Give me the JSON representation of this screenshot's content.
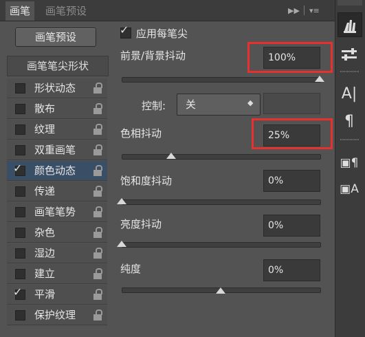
{
  "tabs": [
    {
      "label": "画笔",
      "active": true
    },
    {
      "label": "画笔预设",
      "active": false
    }
  ],
  "panel": {
    "preset_button": "画笔预设",
    "tip_shape_label": "画笔笔尖形状",
    "options": [
      {
        "label": "形状动态",
        "checked": false,
        "selected": false
      },
      {
        "label": "散布",
        "checked": false,
        "selected": false
      },
      {
        "label": "纹理",
        "checked": false,
        "selected": false
      },
      {
        "label": "双重画笔",
        "checked": false,
        "selected": false
      },
      {
        "label": "颜色动态",
        "checked": true,
        "selected": true
      },
      {
        "label": "传递",
        "checked": false,
        "selected": false
      },
      {
        "label": "画笔笔势",
        "checked": false,
        "selected": false
      },
      {
        "label": "杂色",
        "checked": false,
        "selected": false
      },
      {
        "label": "湿边",
        "checked": false,
        "selected": false
      },
      {
        "label": "建立",
        "checked": false,
        "selected": false
      },
      {
        "label": "平滑",
        "checked": true,
        "selected": false
      },
      {
        "label": "保护纹理",
        "checked": false,
        "selected": false
      }
    ]
  },
  "settings": {
    "apply_per_tip": {
      "label": "应用每笔尖",
      "checked": true
    },
    "fg_bg_jitter": {
      "label": "前景/背景抖动",
      "value": "100%",
      "level": 1.0
    },
    "control": {
      "label": "控制:",
      "value": "关",
      "field": ""
    },
    "hue_jitter": {
      "label": "色相抖动",
      "value": "25%",
      "level": 0.25
    },
    "saturation_jitter": {
      "label": "饱和度抖动",
      "value": "0%",
      "level": 0.0
    },
    "brightness_jitter": {
      "label": "亮度抖动",
      "value": "0%",
      "level": 0.0
    },
    "purity": {
      "label": "纯度",
      "value": "0%",
      "level": 0.5
    }
  },
  "colors": {
    "highlight_box": "#e8312f",
    "selected_row": "#3a4f66"
  },
  "toolstrip_icons": [
    "brush-icon",
    "brush-settings-icon",
    "character-icon",
    "paragraph-icon",
    "character-styles-icon",
    "paragraph-styles-icon"
  ]
}
